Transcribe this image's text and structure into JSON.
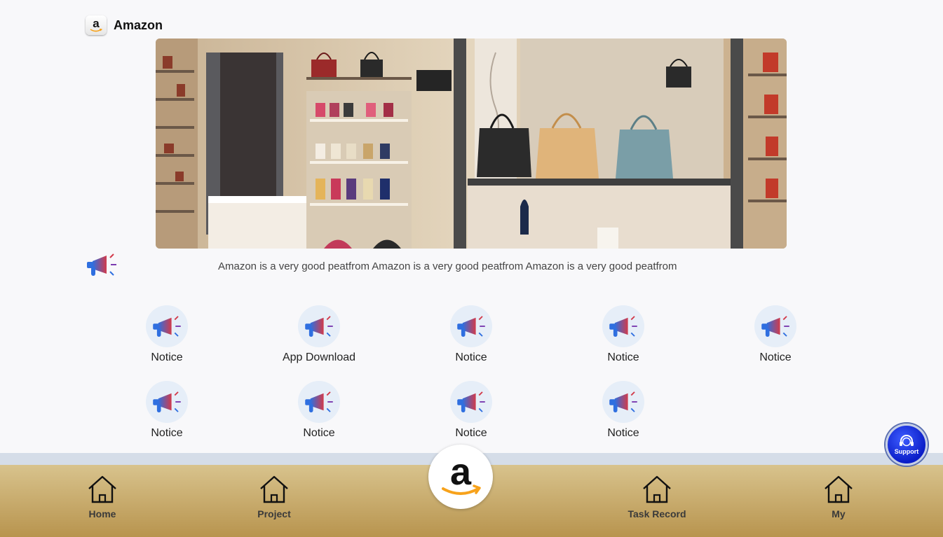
{
  "header": {
    "logo_letter": "a",
    "title": "Amazon"
  },
  "banner": {
    "icon": "store-banner-image"
  },
  "marquee": {
    "icon": "megaphone-icon",
    "text": "Amazon is a very good peatfrom Amazon is a very good peatfrom Amazon is a very good peatfrom"
  },
  "grid": {
    "items": [
      {
        "label": "Notice",
        "icon": "megaphone-icon"
      },
      {
        "label": "App Download",
        "icon": "megaphone-icon"
      },
      {
        "label": "Notice",
        "icon": "megaphone-icon"
      },
      {
        "label": "Notice",
        "icon": "megaphone-icon"
      },
      {
        "label": "Notice",
        "icon": "megaphone-icon"
      },
      {
        "label": "Notice",
        "icon": "megaphone-icon"
      },
      {
        "label": "Notice",
        "icon": "megaphone-icon"
      },
      {
        "label": "Notice",
        "icon": "megaphone-icon"
      },
      {
        "label": "Notice",
        "icon": "megaphone-icon"
      }
    ]
  },
  "nav": {
    "items": [
      {
        "label": "Home",
        "icon": "home-icon"
      },
      {
        "label": "Project",
        "icon": "home-icon"
      },
      {
        "label": "Task Record",
        "icon": "home-icon"
      },
      {
        "label": "My",
        "icon": "home-icon"
      }
    ],
    "center_logo": "amazon-logo-icon"
  },
  "support": {
    "label": "Support",
    "icon": "headset-icon"
  },
  "colors": {
    "background": "#f8f8fa",
    "nav_gradient_top": "#d8c38d",
    "nav_gradient_bottom": "#b8944e",
    "support_blue": "#0a1dc8",
    "amazon_orange": "#f7a21b"
  }
}
